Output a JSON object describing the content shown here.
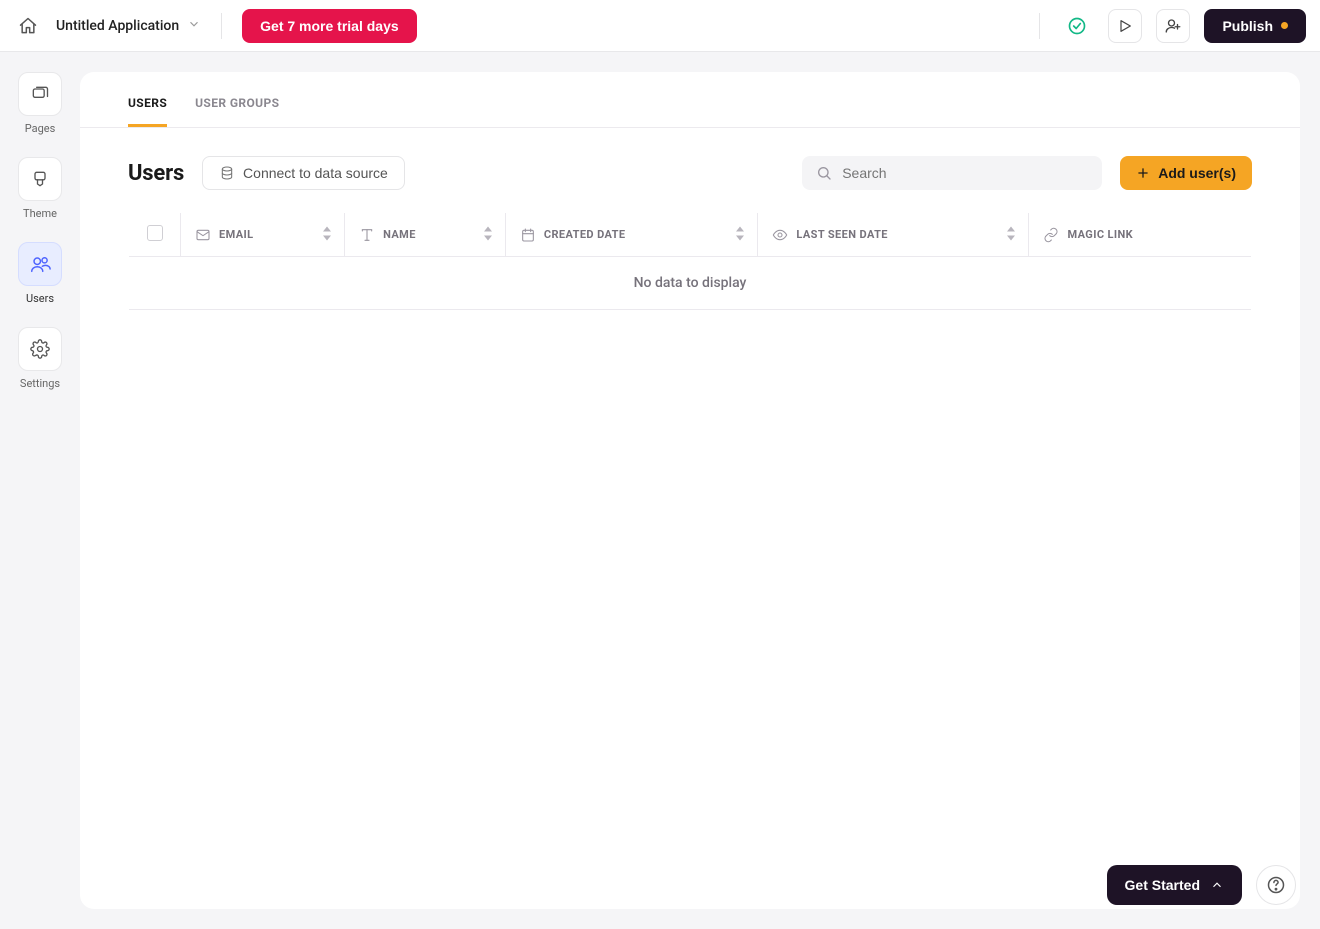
{
  "topbar": {
    "app_title": "Untitled Application",
    "trial_label": "Get 7 more trial days",
    "publish_label": "Publish"
  },
  "sidebar": {
    "items": [
      {
        "label": "Pages"
      },
      {
        "label": "Theme"
      },
      {
        "label": "Users"
      },
      {
        "label": "Settings"
      }
    ]
  },
  "tabs": {
    "items": [
      {
        "label": "USERS",
        "active": true
      },
      {
        "label": "USER GROUPS",
        "active": false
      }
    ]
  },
  "toolbar": {
    "title": "Users",
    "connect_label": "Connect to data source",
    "search_placeholder": "Search",
    "add_label": "Add user(s)"
  },
  "table": {
    "columns": [
      {
        "label": "EMAIL"
      },
      {
        "label": "NAME"
      },
      {
        "label": "CREATED DATE"
      },
      {
        "label": "LAST SEEN DATE"
      },
      {
        "label": "MAGIC LINK"
      }
    ],
    "empty_text": "No data to display"
  },
  "float": {
    "get_started": "Get Started"
  }
}
